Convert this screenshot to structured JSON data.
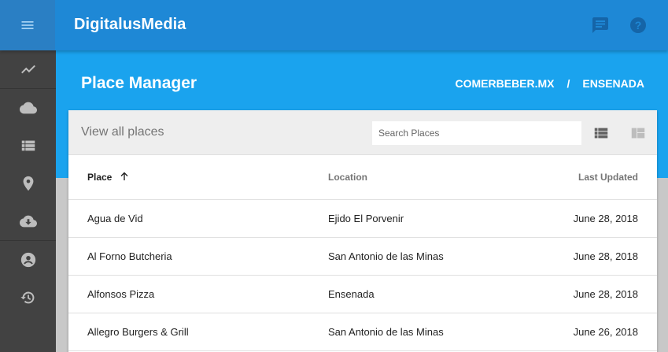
{
  "app": {
    "brand": "DigitalusMedia",
    "colors": {
      "topbar": "#1e88d6",
      "hero": "#1aa3ee",
      "sidebar": "#424242",
      "icon_dark": "#1565a8"
    }
  },
  "topbar": {
    "menu_icon": "menu-icon",
    "icons": [
      "chat-icon",
      "help-icon"
    ]
  },
  "sidebar": {
    "items": [
      "trending-icon",
      "cloud-icon",
      "list-icon",
      "place-icon",
      "cloud-download-icon",
      "account-icon",
      "history-icon"
    ]
  },
  "header": {
    "title": "Place Manager",
    "breadcrumb": [
      "COMERBEBER.MX",
      "/",
      "ENSENADA"
    ]
  },
  "card": {
    "title": "View all places",
    "search_placeholder": "Search Places",
    "view_icons": [
      "list-view-icon",
      "dashboard-view-icon"
    ]
  },
  "table": {
    "columns": [
      "Place",
      "Location",
      "Last Updated"
    ],
    "sort": {
      "column": "Place",
      "direction": "ascending"
    },
    "rows": [
      [
        "Agua de Vid",
        "Ejido El Porvenir",
        "June 28, 2018"
      ],
      [
        "Al Forno Butcheria",
        "San Antonio de las Minas",
        "June 28, 2018"
      ],
      [
        "Alfonsos Pizza",
        "Ensenada",
        "June 28, 2018"
      ],
      [
        "Allegro Burgers & Grill",
        "San Antonio de las Minas",
        "June 26, 2018"
      ]
    ]
  }
}
